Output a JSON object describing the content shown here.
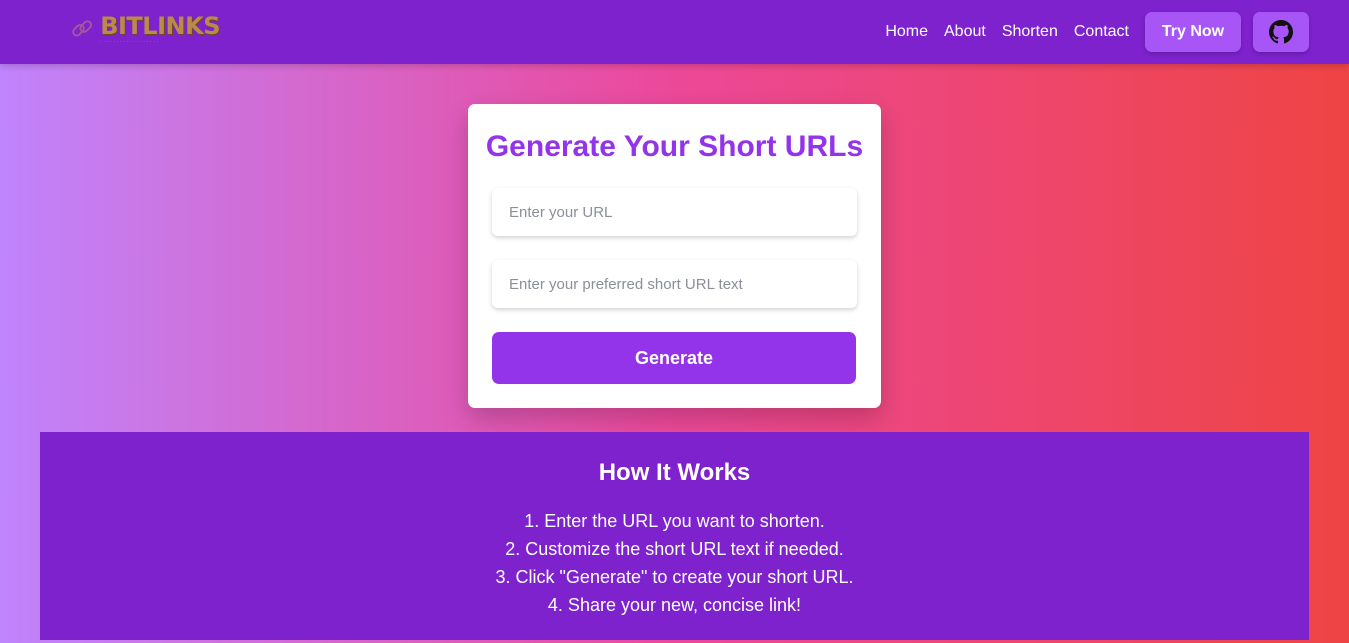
{
  "brand": {
    "name": "BITLINKS",
    "logo_icon": "chain-link-icon",
    "accent_color": "#7e22ce",
    "button_color": "#a855f7",
    "primary_color": "#9333ea"
  },
  "nav": {
    "links": [
      {
        "label": "Home"
      },
      {
        "label": "About"
      },
      {
        "label": "Shorten"
      },
      {
        "label": "Contact"
      }
    ],
    "try_now_label": "Try Now",
    "github_icon": "github-icon"
  },
  "form": {
    "title": "Generate Your Short URLs",
    "url_input": {
      "value": "",
      "placeholder": "Enter your URL"
    },
    "short_input": {
      "value": "",
      "placeholder": "Enter your preferred short URL text"
    },
    "generate_label": "Generate"
  },
  "how_it_works": {
    "title": "How It Works",
    "steps": [
      "1. Enter the URL you want to shorten.",
      "2. Customize the short URL text if needed.",
      "3. Click \"Generate\" to create your short URL.",
      "4. Share your new, concise link!"
    ]
  }
}
